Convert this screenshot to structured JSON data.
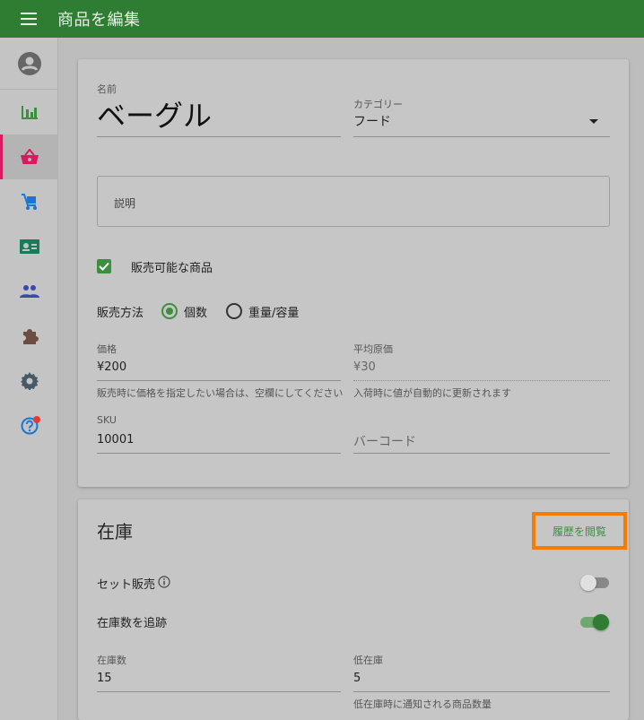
{
  "appbar": {
    "title": "商品を編集"
  },
  "sidebar": {
    "items": [
      {
        "icon": "account-icon"
      },
      {
        "icon": "chart-icon"
      },
      {
        "icon": "basket-icon",
        "active": true
      },
      {
        "icon": "cart-icon"
      },
      {
        "icon": "id-card-icon"
      },
      {
        "icon": "people-icon"
      },
      {
        "icon": "puzzle-icon"
      },
      {
        "icon": "gear-icon"
      },
      {
        "icon": "help-icon",
        "badge": true
      }
    ]
  },
  "product": {
    "name_label": "名前",
    "name_value": "ベーグル",
    "category_label": "カテゴリー",
    "category_value": "フード",
    "description_placeholder": "説明",
    "available_label": "販売可能な商品",
    "sale_method_label": "販売方法",
    "sale_options": [
      "個数",
      "重量/容量"
    ],
    "sale_selected": "個数",
    "price_label": "価格",
    "price_value": "¥200",
    "price_helper": "販売時に価格を指定したい場合は、空欄にしてください",
    "cost_label": "平均原価",
    "cost_value": "¥30",
    "cost_helper": "入荷時に値が自動的に更新されます",
    "sku_label": "SKU",
    "sku_value": "10001",
    "barcode_placeholder": "バーコード"
  },
  "inventory": {
    "title": "在庫",
    "history_button": "履歴を閲覧",
    "composite_label": "セット販売",
    "composite_on": false,
    "track_label": "在庫数を追跡",
    "track_on": true,
    "stock_label": "在庫数",
    "stock_value": "15",
    "low_stock_label": "低在庫",
    "low_stock_value": "5",
    "low_stock_helper": "低在庫時に通知される商品数量"
  },
  "colors": {
    "appbar": "#2e7d32",
    "accent": "#3e8e41",
    "active_indicator": "#d81b60",
    "highlight": "#f57c00"
  }
}
